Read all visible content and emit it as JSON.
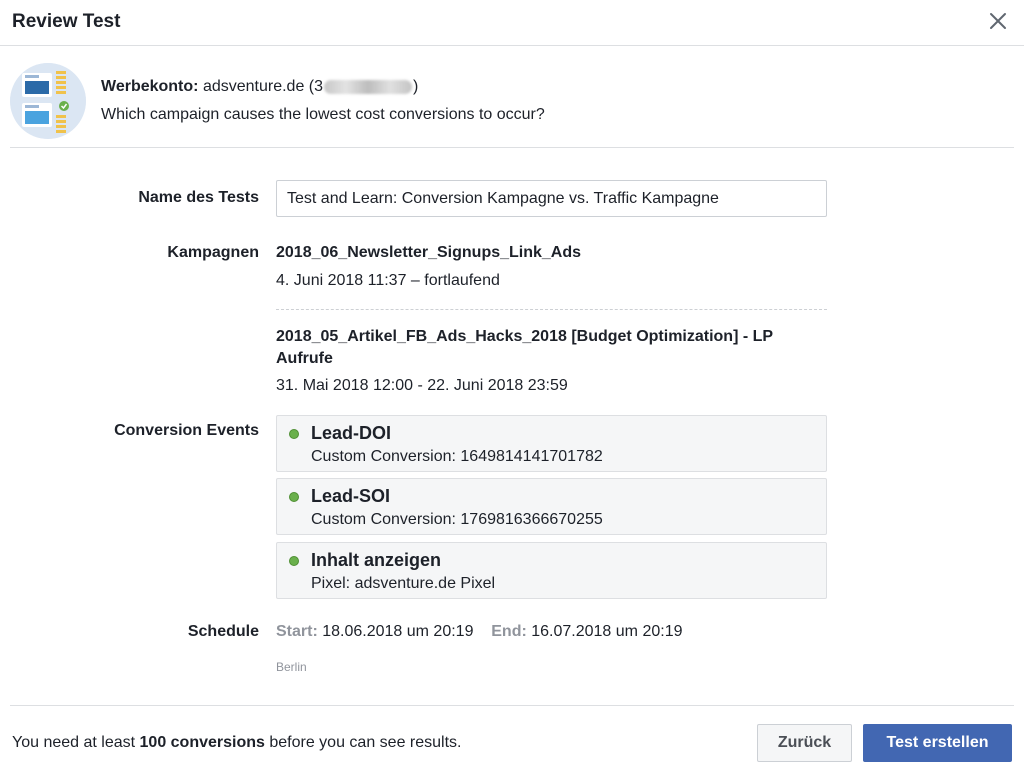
{
  "dialog": {
    "title": "Review Test"
  },
  "account": {
    "label": "Werbekonto:",
    "name": "adsventure.de",
    "id_open": "(3",
    "id_close": ")",
    "question": "Which campaign causes the lowest cost conversions to occur?"
  },
  "fields": {
    "name_label": "Name des Tests",
    "name_value": "Test and Learn: Conversion Kampagne vs. Traffic Kampagne",
    "campaigns_label": "Kampagnen",
    "events_label": "Conversion Events",
    "schedule_label": "Schedule"
  },
  "campaigns": [
    {
      "name": "2018_06_Newsletter_Signups_Link_Ads",
      "dates": "4. Juni 2018 11:37 – fortlaufend"
    },
    {
      "name": "2018_05_Artikel_FB_Ads_Hacks_2018 [Budget Optimization] - LP Aufrufe",
      "dates": "31. Mai 2018 12:00 - 22. Juni 2018 23:59"
    }
  ],
  "events": [
    {
      "name": "Lead-DOI",
      "detail": "Custom Conversion: 1649814141701782",
      "status_color": "#6ab04c"
    },
    {
      "name": "Lead-SOI",
      "detail": "Custom Conversion: 1769816366670255",
      "status_color": "#6ab04c"
    },
    {
      "name": "Inhalt anzeigen",
      "detail": "Pixel: adsventure.de Pixel",
      "status_color": "#6ab04c"
    }
  ],
  "schedule": {
    "start_label": "Start:",
    "start_value": "18.06.2018 um 20:19",
    "end_label": "End:",
    "end_value": "16.07.2018 um 20:19",
    "timezone": "Berlin"
  },
  "footer": {
    "text_before": "You need at least ",
    "text_bold": "100 conversions",
    "text_after": " before you can see results.",
    "back_button": "Zurück",
    "create_button": "Test erstellen"
  },
  "colors": {
    "primary": "#4267b2",
    "status_active": "#6ab04c",
    "border": "#dddfe2"
  },
  "icons": {
    "close": "close-icon",
    "account": "ad-account-avatar-icon",
    "status": "status-dot-icon"
  }
}
